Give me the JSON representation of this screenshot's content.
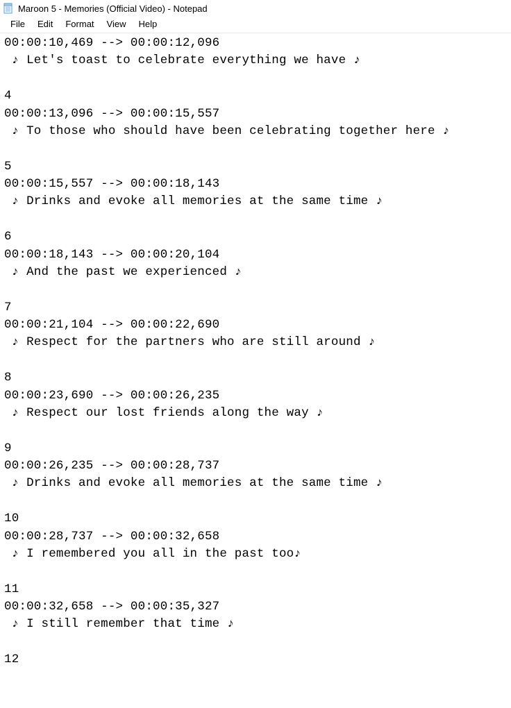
{
  "window": {
    "title": "Maroon 5 - Memories (Official Video) - Notepad",
    "icon": "notepad-icon"
  },
  "menu": {
    "items": [
      "File",
      "Edit",
      "Format",
      "View",
      "Help"
    ]
  },
  "content": {
    "lines": [
      "00:00:10,469 --> 00:00:12,096",
      " ♪ Let's toast to celebrate everything we have ♪",
      "",
      "4",
      "00:00:13,096 --> 00:00:15,557",
      " ♪ To those who should have been celebrating together here ♪",
      "",
      "5",
      "00:00:15,557 --> 00:00:18,143",
      " ♪ Drinks and evoke all memories at the same time ♪",
      "",
      "6",
      "00:00:18,143 --> 00:00:20,104",
      " ♪ And the past we experienced ♪",
      "",
      "7",
      "00:00:21,104 --> 00:00:22,690",
      " ♪ Respect for the partners who are still around ♪",
      "",
      "8",
      "00:00:23,690 --> 00:00:26,235",
      " ♪ Respect our lost friends along the way ♪",
      "",
      "9",
      "00:00:26,235 --> 00:00:28,737",
      " ♪ Drinks and evoke all memories at the same time ♪",
      "",
      "10",
      "00:00:28,737 --> 00:00:32,658",
      " ♪ I remembered you all in the past too♪",
      "",
      "11",
      "00:00:32,658 --> 00:00:35,327",
      " ♪ I still remember that time ♪",
      "",
      "12"
    ]
  }
}
